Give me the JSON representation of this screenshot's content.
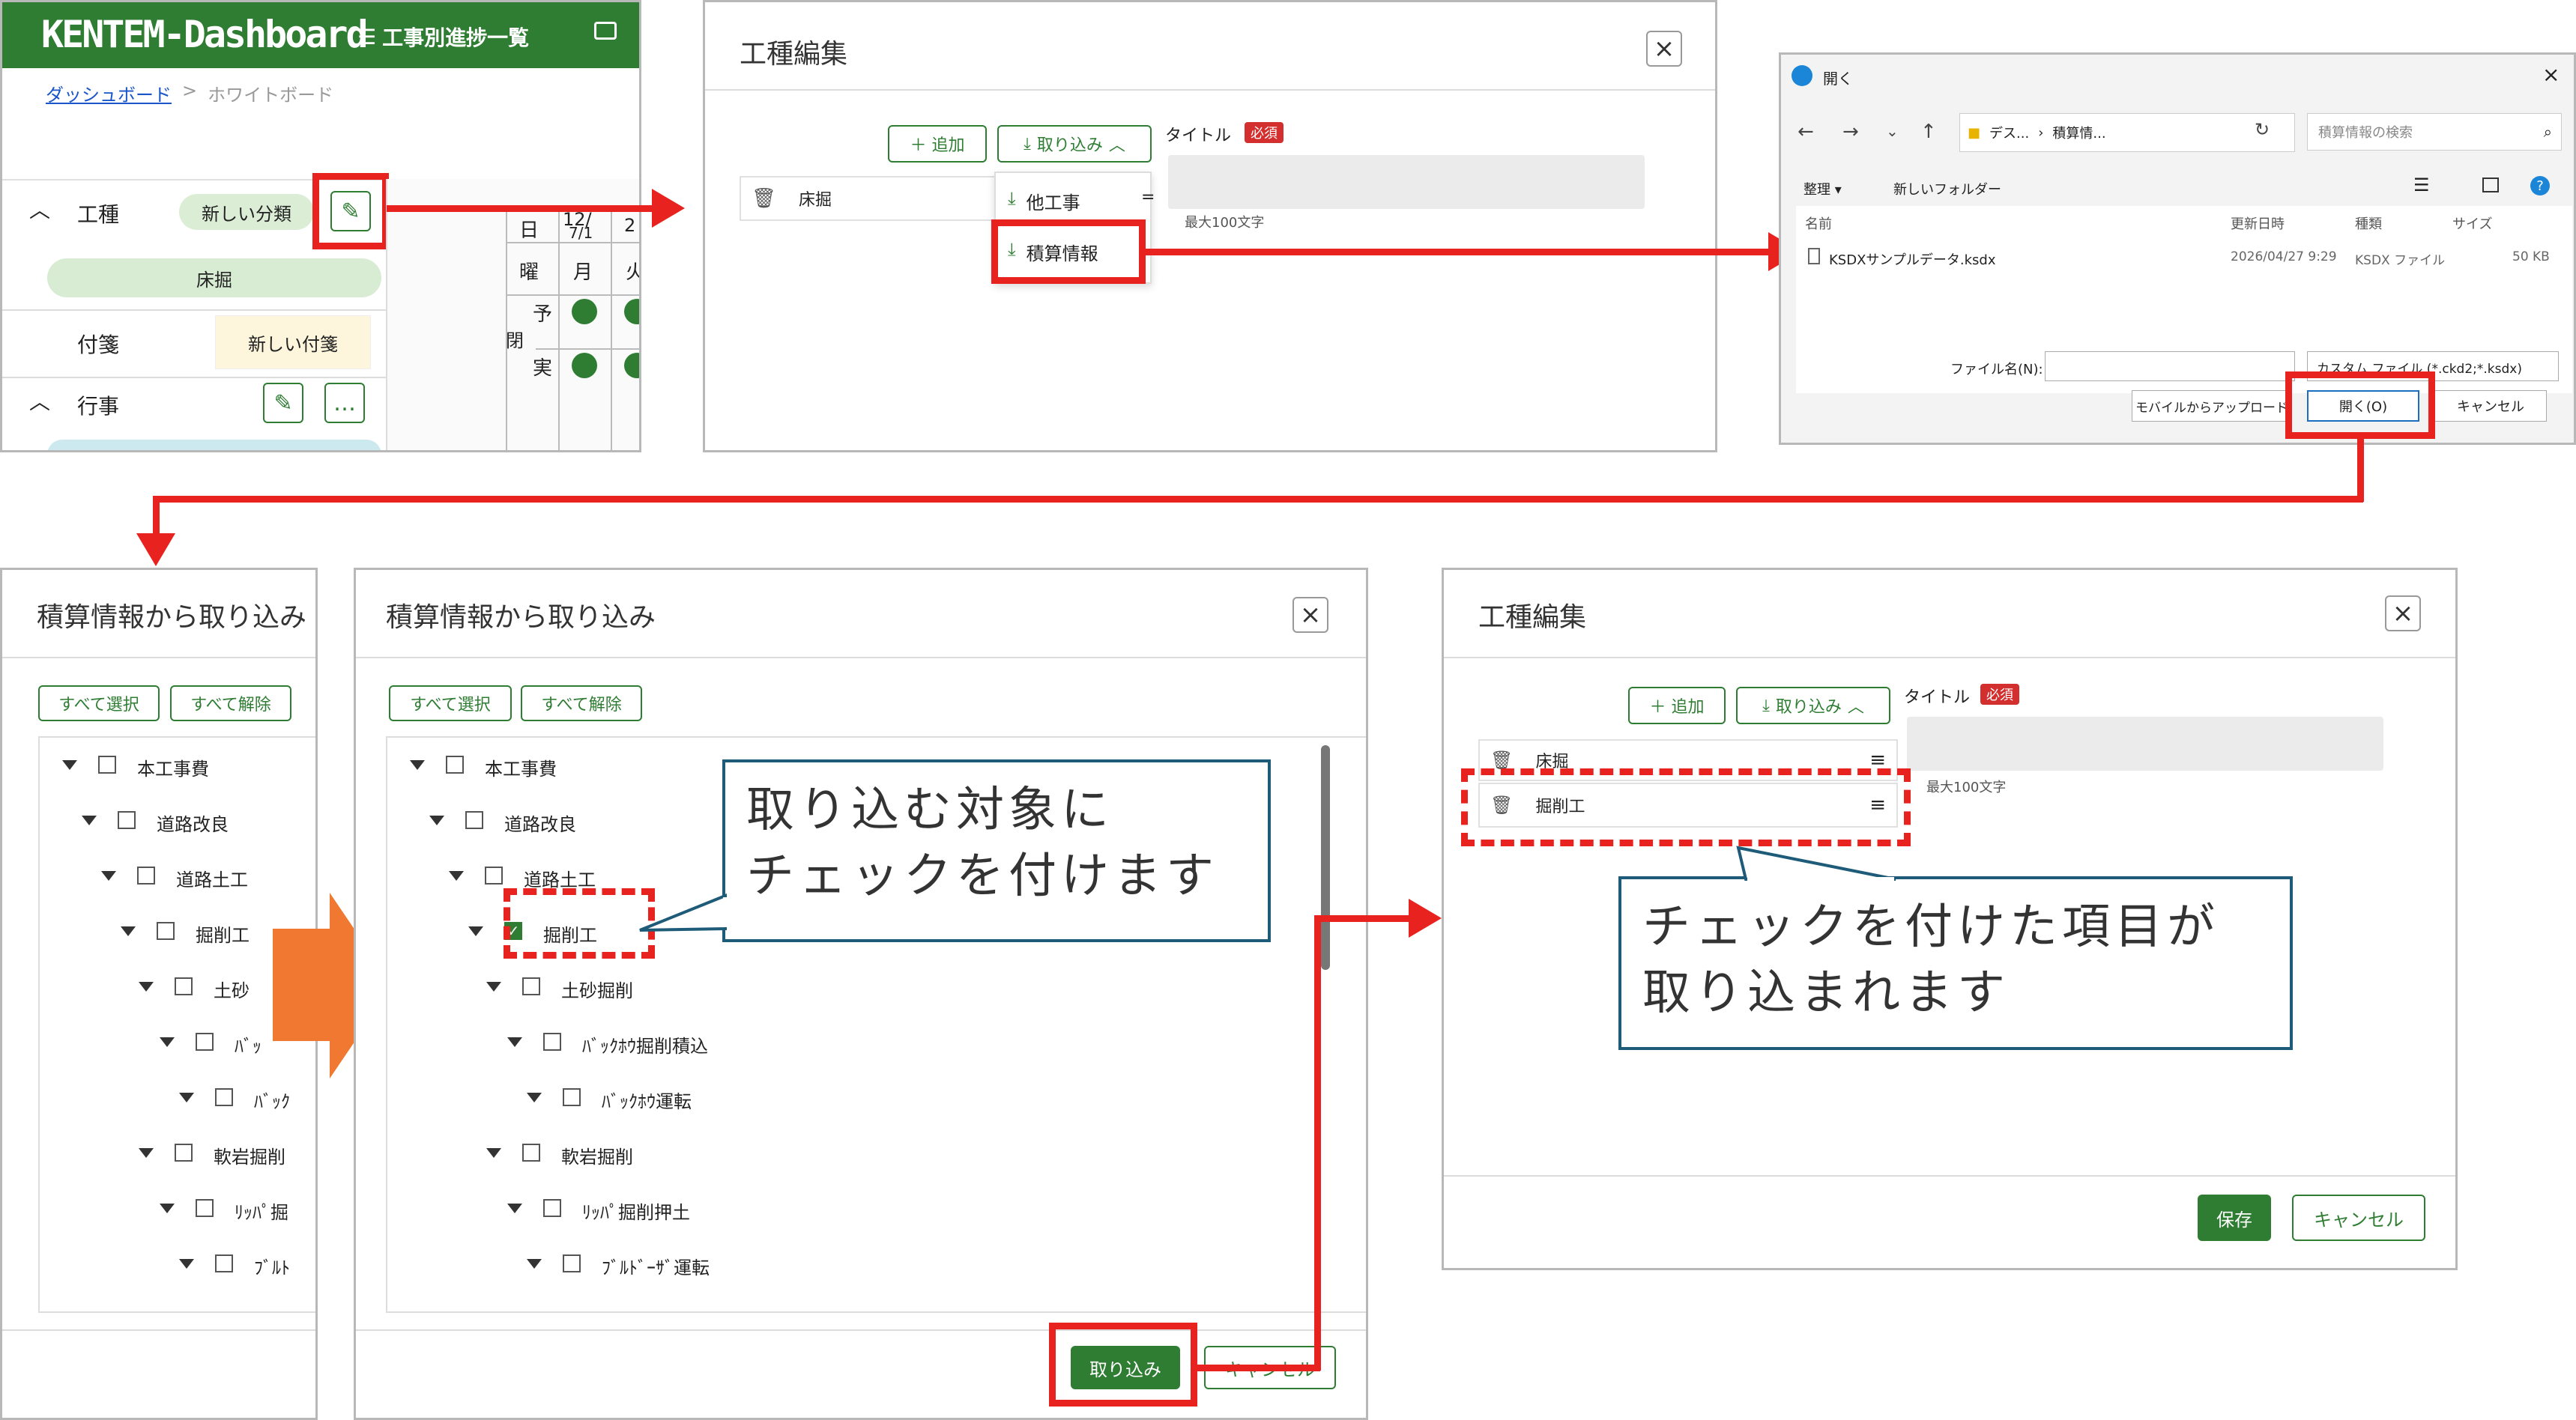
{
  "dashboard": {
    "brand": "KENTEM-Dashboard",
    "nav_label": "工事別進捗一覧",
    "breadcrumb_link": "ダッシュボード",
    "breadcrumb_sep": ">",
    "breadcrumb_current": "ホワイトボード",
    "section_kouji": "工種",
    "new_category_button": "新しい分類",
    "category_chip": "床掘",
    "section_fusen": "付箋",
    "new_fusen_button": "新しい付箋",
    "section_gyouji": "行事",
    "more_label": "…",
    "cal_day": "日",
    "cal_date1": "12/",
    "cal_date1b": "7/1",
    "cal_date2": "2",
    "cal_youbi": "曜",
    "cal_mon": "月",
    "cal_tue": "火",
    "cal_yotei": "予",
    "cal_kan": "閉",
    "cal_jisseki": "実"
  },
  "kousyu_edit_1": {
    "title": "工種編集",
    "close": "×",
    "add_button": "＋ 追加",
    "import_button": "取り込み",
    "title_label": "タイトル",
    "required_badge": "必須",
    "row_label": "床掘",
    "menu_other": "他工事",
    "menu_sekisan": "積算情報",
    "max_chars": "最大100文字"
  },
  "file_dialog": {
    "title": "開く",
    "path_1": "デス...",
    "path_2": "積算情...",
    "search_placeholder": "積算情報の検索",
    "organize": "整理 ▾",
    "new_folder": "新しいフォルダー",
    "col_name": "名前",
    "col_modified": "更新日時",
    "col_type": "種類",
    "col_size": "サイズ",
    "file_name": "KSDXサンプルデータ.ksdx",
    "file_date": "2026/04/27 9:29",
    "file_type": "KSDX ファイル",
    "file_size": "50 KB",
    "filename_label": "ファイル名(N):",
    "filter": "カスタム ファイル (*.ckd2;*.ksdx)",
    "mobile_upload": "モバイルからアップロード",
    "open_button": "開く(O)",
    "cancel_button": "キャンセル"
  },
  "import_dialog": {
    "title": "積算情報から取り込み",
    "select_all": "すべて選択",
    "deselect_all": "すべて解除",
    "tree": [
      "本工事費",
      "道路改良",
      "道路土工",
      "掘削工",
      "土砂掘削",
      "ﾊﾞｯｸﾎｳ掘削積込",
      "ﾊﾞｯｸﾎｳ運転",
      "軟岩掘削",
      "ﾘｯﾊﾟ掘削押土",
      "ﾌﾞﾙﾄﾞｰｻﾞ運転"
    ],
    "import_button": "取り込み",
    "cancel_button": "キャンセル"
  },
  "import_dialog_left": {
    "title": "積算情報から取り込み",
    "tree_trunc": [
      "本工事費",
      "道路改良",
      "道路土工",
      "掘削工",
      "土砂",
      "ﾊﾞｯ",
      "ﾊﾞｯｸ",
      "軟岩掘削",
      "ﾘｯﾊﾟ掘",
      "ﾌﾞﾙﾄ"
    ]
  },
  "kousyu_edit_2": {
    "title": "工種編集",
    "close": "×",
    "add_button": "＋ 追加",
    "import_button": "取り込み",
    "title_label": "タイトル",
    "required_badge": "必須",
    "row1": "床掘",
    "row2": "掘削工",
    "max_chars": "最大100文字",
    "save_button": "保存",
    "cancel_button": "キャンセル"
  },
  "callouts": {
    "check_target": "取り込む対象に\nチェックを付けます",
    "imported": "チェックを付けた項目が\n取り込まれます"
  },
  "colors": {
    "accent_green": "#2e7d32",
    "highlight_red": "#e8231f",
    "callout_border": "#1e5b78",
    "arrow_orange": "#f07830"
  }
}
